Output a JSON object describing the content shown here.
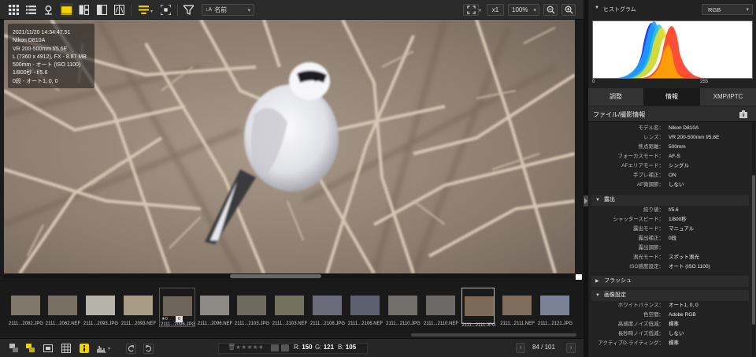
{
  "toolbar": {
    "sort_label": "名前",
    "zoom_x": "x1",
    "zoom_percent": "100%"
  },
  "overlay": {
    "lines": [
      "2021/11/20 14:34:47.51",
      "Nikon D810A",
      "VR 200-500mm f/5.6E",
      "L (7360 x 4912), FX - 8.87 MB",
      "500mm - オート (ISO 1100)",
      "1/800秒 - f/5.6",
      "0段 - オート1, 0, 0"
    ]
  },
  "filmstrip": {
    "items": [
      {
        "label": "2111...2082.JPG",
        "color": "#7e776a"
      },
      {
        "label": "2111...2082.NEF",
        "color": "#777063"
      },
      {
        "label": "2111...2093.JPG",
        "color": "#b6b3aa"
      },
      {
        "label": "2111...2093.NEF",
        "color": "#a79b84"
      },
      {
        "label": "2111...2096.JPG",
        "color": "#6d655c",
        "badge_left": "★0",
        "badge_box": "0"
      },
      {
        "label": "2111...2096.NEF",
        "color": "#8c8a84"
      },
      {
        "label": "2111...2103.JPG",
        "color": "#6f6a5f"
      },
      {
        "label": "2111...2103.NEF",
        "color": "#75715f"
      },
      {
        "label": "2111...2106.JPG",
        "color": "#6a6a78"
      },
      {
        "label": "2111...2106.NEF",
        "color": "#5c6170"
      },
      {
        "label": "2111...2110.JPG",
        "color": "#706f69"
      },
      {
        "label": "2111...2110.NEF",
        "color": "#6c6a66"
      },
      {
        "label": "2111...2111.JPG",
        "color": "#7b6a57"
      },
      {
        "label": "2111...2111.NEF",
        "color": "#806e5d"
      },
      {
        "label": "2111...2121.JPG",
        "color": "#7c8296"
      }
    ]
  },
  "status": {
    "r_label": "R:",
    "r_value": "150",
    "g_label": "G:",
    "g_value": "121",
    "b_label": "B:",
    "b_value": "105",
    "page_current": "84",
    "page_sep": "/",
    "page_total": "101"
  },
  "histogram": {
    "title": "ヒストグラム",
    "channel": "RGB",
    "axis_min": "0",
    "axis_max": "255"
  },
  "tabs": [
    {
      "label": "調整"
    },
    {
      "label": "情報"
    },
    {
      "label": "XMP/IPTC"
    }
  ],
  "info": {
    "section_title": "ファイル/撮影情報",
    "camera": [
      {
        "k": "モデル名：",
        "v": "Nikon D810A"
      },
      {
        "k": "レンズ：",
        "v": "VR 200-500mm f/5.6E"
      },
      {
        "k": "焦点距離：",
        "v": "500mm"
      },
      {
        "k": "フォーカスモード：",
        "v": "AF-S"
      },
      {
        "k": "AFエリアモード：",
        "v": "シングル"
      },
      {
        "k": "手ブレ補正：",
        "v": "ON"
      },
      {
        "k": "AF微調節：",
        "v": "しない"
      }
    ],
    "exposure_title": "露出",
    "exposure": [
      {
        "k": "絞り値：",
        "v": "f/5.6"
      },
      {
        "k": "シャッタースピード：",
        "v": "1/800秒"
      },
      {
        "k": "露出モード：",
        "v": "マニュアル"
      },
      {
        "k": "露出補正：",
        "v": "0段"
      },
      {
        "k": "露出調節：",
        "v": ""
      },
      {
        "k": "測光モード：",
        "v": "スポット測光"
      },
      {
        "k": "ISO感度設定：",
        "v": "オート (ISO 1100)"
      }
    ],
    "flash_title": "フラッシュ",
    "image_title": "画像設定",
    "image": [
      {
        "k": "ホワイトバランス：",
        "v": "オート1, 0, 0"
      },
      {
        "k": "色空間：",
        "v": "Adobe RGB"
      },
      {
        "k": "高感度ノイズ低減：",
        "v": "標準"
      },
      {
        "k": "長秒時ノイズ低減：",
        "v": "しない"
      },
      {
        "k": "アクティブD-ライティング：",
        "v": "標準"
      }
    ]
  }
}
